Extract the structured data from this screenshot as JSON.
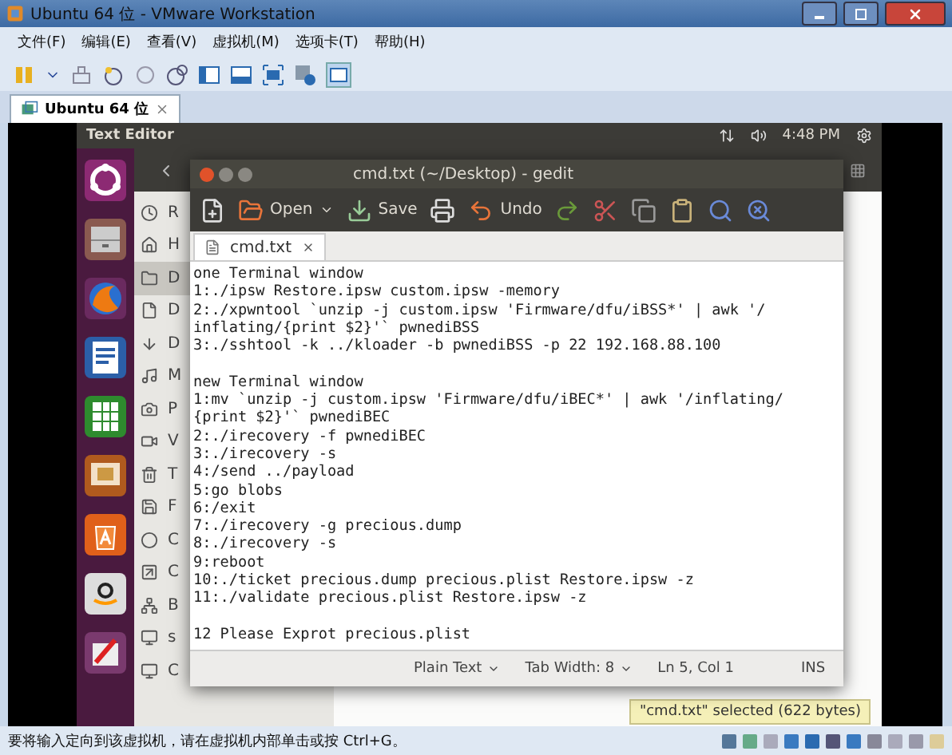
{
  "window": {
    "title": "Ubuntu 64 位 - VMware Workstation"
  },
  "menu": [
    "文件(F)",
    "编辑(E)",
    "查看(V)",
    "虚拟机(M)",
    "选项卡(T)",
    "帮助(H)"
  ],
  "tabs": [
    {
      "label": "Ubuntu 64 位",
      "selected": true
    }
  ],
  "ubuntu_panel": {
    "app_title": "Text Editor",
    "clock": "4:48 PM"
  },
  "files_sidebar": [
    {
      "label": "R",
      "selected": false
    },
    {
      "label": "H",
      "selected": false
    },
    {
      "label": "D",
      "selected": true
    },
    {
      "label": "D",
      "selected": false
    },
    {
      "label": "D",
      "selected": false
    },
    {
      "label": "M",
      "selected": false
    },
    {
      "label": "P",
      "selected": false
    },
    {
      "label": "V",
      "selected": false
    },
    {
      "label": "T",
      "selected": false
    },
    {
      "label": "F",
      "selected": false
    },
    {
      "label": "C",
      "selected": false
    },
    {
      "label": "C",
      "selected": false
    },
    {
      "label": "B",
      "selected": false
    },
    {
      "label": "s",
      "selected": false
    },
    {
      "label": "C",
      "selected": false
    }
  ],
  "gedit": {
    "title": "cmd.txt (~/Desktop) - gedit",
    "buttons": [
      "Open",
      "Save",
      "Undo"
    ],
    "tabs": [
      {
        "label": "cmd.txt",
        "selected": true
      }
    ],
    "paragraphs": [
      [
        "one Terminal window",
        "1:./ipsw Restore.ipsw custom.ipsw -memory",
        "2:./xpwntool `unzip -j custom.ipsw 'Firmware/dfu/iBSS*' | awk '/",
        "inflating/{print $2}'` pwnediBSS",
        "3:./sshtool -k ../kloader -b pwnediBSS -p 22 192.168.88.100"
      ],
      [
        "new Terminal window",
        "1:mv `unzip -j custom.ipsw 'Firmware/dfu/iBEC*' | awk '/inflating/",
        "{print $2}'` pwnediBEC",
        "2:./irecovery -f pwnediBEC",
        "3:./irecovery -s",
        "4:/send ../payload",
        "5:go blobs",
        "6:/exit",
        "7:./irecovery -g precious.dump",
        "8:./irecovery -s",
        "9:reboot",
        "10:./ticket precious.dump precious.plist Restore.ipsw -z",
        "11:./validate precious.plist Restore.ipsw -z"
      ],
      [
        "12 Please Exprot precious.plist"
      ]
    ],
    "status": [
      {
        "label": "Plain Text",
        "dropdown": true
      },
      {
        "label": "Tab Width: 8",
        "dropdown": true
      },
      {
        "label": "Ln 5, Col 1",
        "dropdown": false
      },
      {
        "label": "INS",
        "dropdown": false
      }
    ]
  },
  "notification": "\"cmd.txt\" selected  (622 bytes)",
  "status_bar": "要将输入定向到该虚拟机，请在虚拟机内部单击或按 Ctrl+G。"
}
